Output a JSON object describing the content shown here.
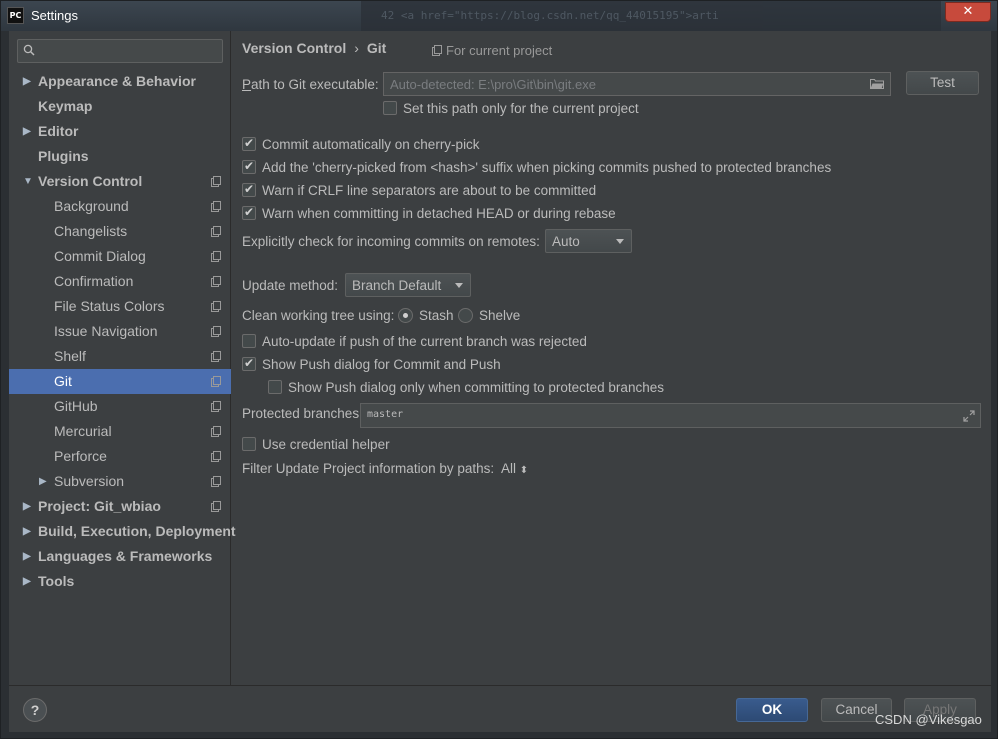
{
  "window": {
    "title": "Settings",
    "app_icon": "PC",
    "close_label": "✕",
    "background_code": "42        <a href=\"https://blog.csdn.net/qq_44015195\">arti"
  },
  "sidebar": {
    "search_placeholder": "",
    "items": [
      {
        "label": "Appearance & Behavior",
        "bold": true,
        "expandable": true
      },
      {
        "label": "Keymap",
        "bold": true
      },
      {
        "label": "Editor",
        "bold": true,
        "expandable": true
      },
      {
        "label": "Plugins",
        "bold": true
      },
      {
        "label": "Version Control",
        "bold": true,
        "expanded": true
      },
      {
        "label": "Background"
      },
      {
        "label": "Changelists"
      },
      {
        "label": "Commit Dialog"
      },
      {
        "label": "Confirmation"
      },
      {
        "label": "File Status Colors"
      },
      {
        "label": "Issue Navigation"
      },
      {
        "label": "Shelf"
      },
      {
        "label": "Git",
        "selected": true
      },
      {
        "label": "GitHub"
      },
      {
        "label": "Mercurial"
      },
      {
        "label": "Perforce"
      },
      {
        "label": "Subversion",
        "expandable": true
      },
      {
        "label": "Project: Git_wbiao",
        "bold": true,
        "expandable": true
      },
      {
        "label": "Build, Execution, Deployment",
        "bold": true,
        "expandable": true
      },
      {
        "label": "Languages & Frameworks",
        "bold": true,
        "expandable": true
      },
      {
        "label": "Tools",
        "bold": true,
        "expandable": true
      }
    ]
  },
  "main": {
    "breadcrumb": {
      "parent": "Version Control",
      "separator": "›",
      "current": "Git"
    },
    "scope_label": "For current project",
    "path_label": "Path to Git executable:",
    "path_value": "Auto-detected: E:\\pro\\Git\\bin\\git.exe",
    "test_button": "Test",
    "current_project_only": {
      "label": "Set this path only for the current project",
      "checked": false
    },
    "options": [
      {
        "label": "Commit automatically on cherry-pick",
        "checked": true
      },
      {
        "label": "Add the 'cherry-picked from <hash>' suffix when picking commits pushed to protected branches",
        "checked": true
      },
      {
        "label": "Warn if CRLF line separators are about to be committed",
        "checked": true
      },
      {
        "label": "Warn when committing in detached HEAD or during rebase",
        "checked": true
      }
    ],
    "incoming_label": "Explicitly check for incoming commits on remotes:",
    "incoming_value": "Auto",
    "update_method_label": "Update method:",
    "update_method_value": "Branch Default",
    "clean_tree_label": "Clean working tree using:",
    "stash_label": "Stash",
    "stash_selected": true,
    "shelve_label": "Shelve",
    "auto_update": {
      "label": "Auto-update if push of the current branch was rejected",
      "checked": false
    },
    "show_push": {
      "label": "Show Push dialog for Commit and Push",
      "checked": true
    },
    "show_push_protected": {
      "label": "Show Push dialog only when committing to protected branches",
      "checked": false
    },
    "protected_label": "Protected branches:",
    "protected_value": "master",
    "credential_helper": {
      "label": "Use credential helper",
      "checked": false
    },
    "filter_label": "Filter Update Project information by paths:",
    "filter_value": "All",
    "filter_caret": "⬍"
  },
  "footer": {
    "help_label": "?",
    "ok_label": "OK",
    "cancel_label": "Cancel",
    "apply_label": "Apply"
  },
  "watermark": "CSDN @Vikesgao",
  "colors": {
    "selection": "#4b6eaf",
    "panel": "#3c3f41",
    "close": "#c74a3c"
  }
}
